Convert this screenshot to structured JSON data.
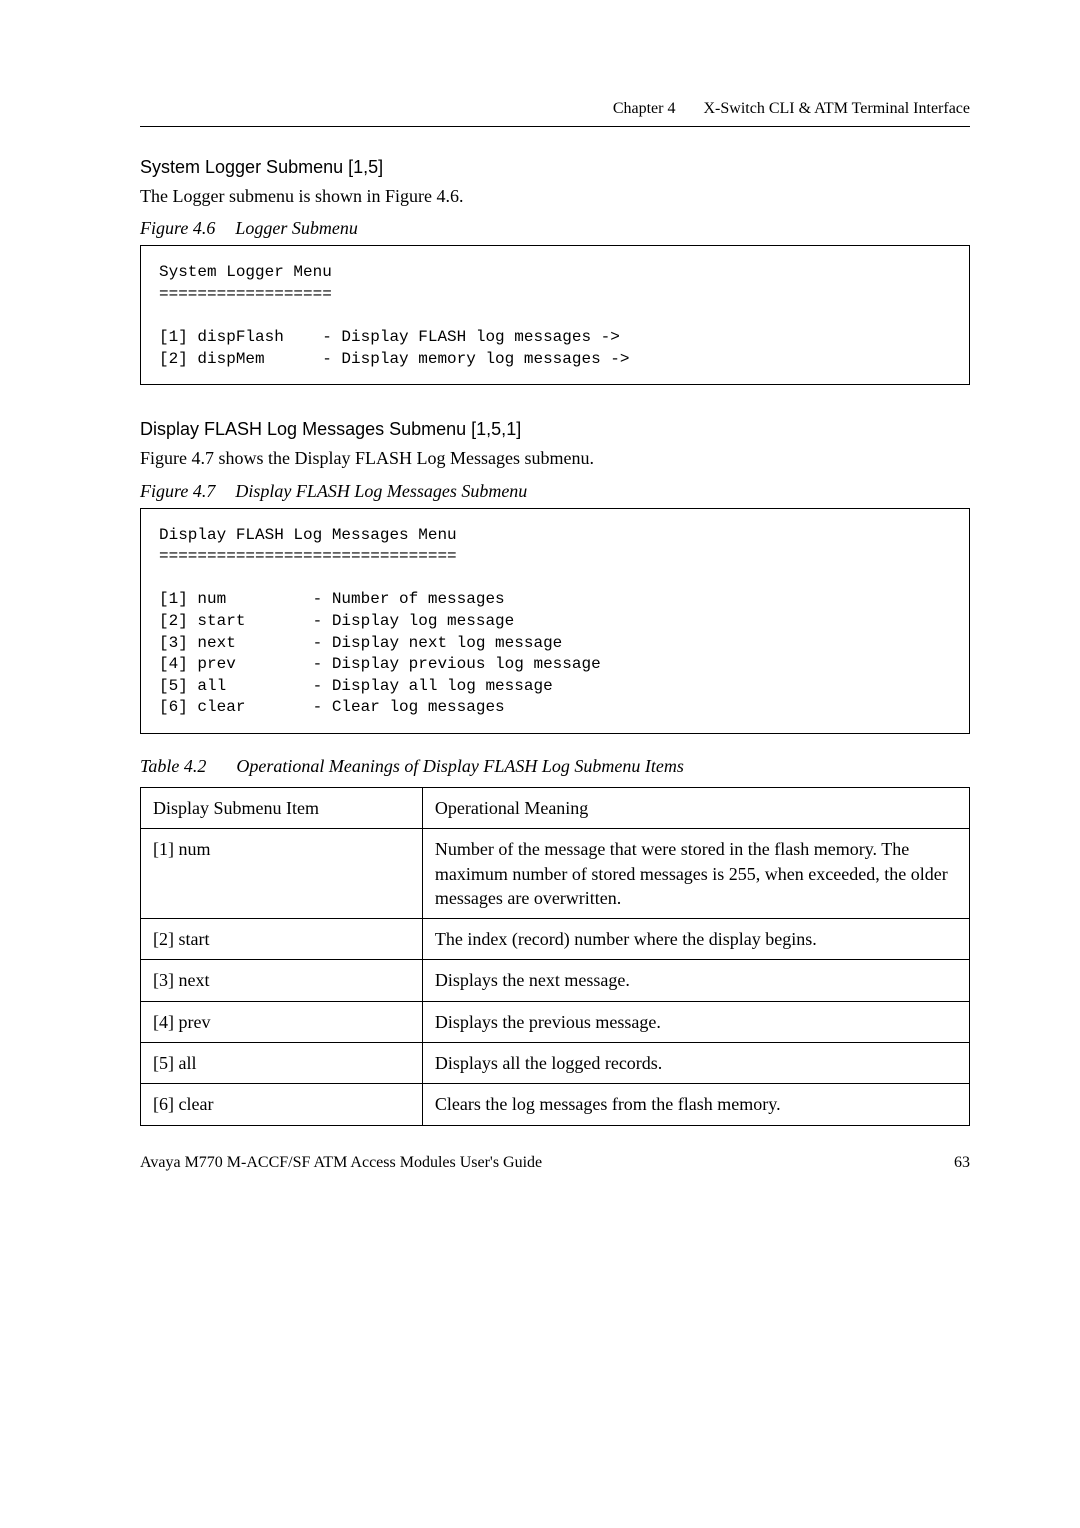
{
  "header": {
    "chapter": "Chapter 4",
    "title": "X-Switch CLI & ATM Terminal Interface"
  },
  "section1": {
    "heading": "System Logger Submenu [1,5]",
    "intro": "The Logger submenu is shown in Figure 4.6.",
    "figure": {
      "label": "Figure 4.6",
      "title": "Logger Submenu",
      "code": "System Logger Menu\n==================\n\n[1] dispFlash    - Display FLASH log messages ->\n[2] dispMem      - Display memory log messages ->"
    }
  },
  "section2": {
    "heading": "Display FLASH Log Messages Submenu [1,5,1]",
    "intro": "Figure 4.7 shows the Display FLASH Log Messages submenu.",
    "figure": {
      "label": "Figure 4.7",
      "title": "Display FLASH Log Messages Submenu",
      "code": "Display FLASH Log Messages Menu\n===============================\n\n[1] num         - Number of messages\n[2] start       - Display log message\n[3] next        - Display next log message\n[4] prev        - Display previous log message\n[5] all         - Display all log message\n[6] clear       - Clear log messages"
    }
  },
  "table": {
    "label": "Table 4.2",
    "title": "Operational Meanings of Display FLASH Log Submenu Items",
    "headers": [
      "Display Submenu Item",
      "Operational Meaning"
    ],
    "rows": [
      [
        "[1] num",
        "Number of the message that were stored in the flash memory. The maximum number of stored messages is 255, when exceeded, the older messages are overwritten."
      ],
      [
        "[2] start",
        "The index (record) number where the display begins."
      ],
      [
        "[3] next",
        "Displays the next message."
      ],
      [
        "[4] prev",
        "Displays the previous message."
      ],
      [
        "[5] all",
        "Displays all the logged records."
      ],
      [
        "[6] clear",
        "Clears the log messages from the flash memory."
      ]
    ]
  },
  "footer": {
    "left": "Avaya M770 M-ACCF/SF ATM Access Modules User's Guide",
    "right": "63"
  }
}
